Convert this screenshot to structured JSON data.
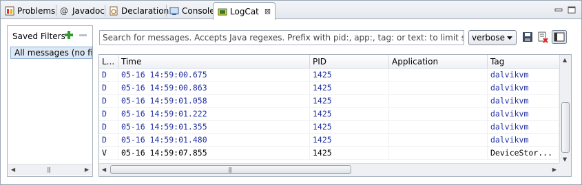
{
  "tabs": [
    {
      "label": "Problems",
      "icon": "problems-icon"
    },
    {
      "label": "Javadoc",
      "icon": "at-icon"
    },
    {
      "label": "Declaration",
      "icon": "declaration-icon"
    },
    {
      "label": "Console",
      "icon": "console-icon"
    },
    {
      "label": "LogCat",
      "icon": "logcat-icon",
      "active": true,
      "close": "⊠"
    }
  ],
  "saved_filters": {
    "title": "Saved Filters",
    "items": [
      "All messages (no filters)"
    ]
  },
  "search": {
    "placeholder": "Search for messages. Accepts Java regexes. Prefix with pid:, app:, tag: or text: to limit scope."
  },
  "log_level": {
    "selected": "verbose"
  },
  "table": {
    "columns": [
      "L...",
      "Time",
      "PID",
      "Application",
      "Tag"
    ],
    "rows": [
      {
        "level": "D",
        "time": "05-16 14:59:00.675",
        "pid": "1425",
        "app": "",
        "tag": "dalvikvm"
      },
      {
        "level": "D",
        "time": "05-16 14:59:00.863",
        "pid": "1425",
        "app": "",
        "tag": "dalvikvm"
      },
      {
        "level": "D",
        "time": "05-16 14:59:01.058",
        "pid": "1425",
        "app": "",
        "tag": "dalvikvm"
      },
      {
        "level": "D",
        "time": "05-16 14:59:01.222",
        "pid": "1425",
        "app": "",
        "tag": "dalvikvm"
      },
      {
        "level": "D",
        "time": "05-16 14:59:01.355",
        "pid": "1425",
        "app": "",
        "tag": "dalvikvm"
      },
      {
        "level": "D",
        "time": "05-16 14:59:01.480",
        "pid": "1425",
        "app": "",
        "tag": "dalvikvm"
      },
      {
        "level": "V",
        "time": "05-16 14:59:07.855",
        "pid": "1425",
        "app": "",
        "tag": "DeviceStor..."
      }
    ]
  },
  "colors": {
    "debug_text": "#1e2ea0",
    "verbose_text": "#000000",
    "selection": "#dde8f4",
    "add_green": "#2e9d2e"
  }
}
